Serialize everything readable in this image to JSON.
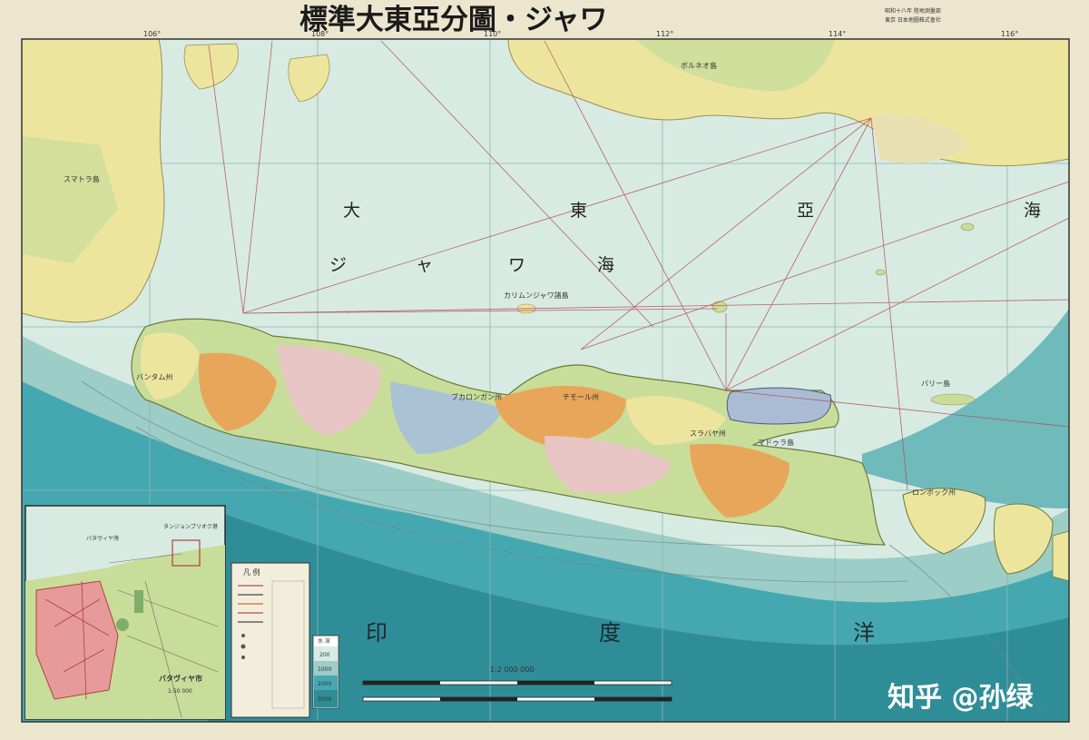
{
  "map": {
    "title": "標準大東亞分圖・ジャワ",
    "sea_labels": [
      "大",
      "東",
      "亞",
      "海",
      "ジ",
      "ャ",
      "ワ",
      "海"
    ],
    "ocean_labels": [
      "印",
      "度",
      "洋"
    ],
    "regions": [
      "バンタム州",
      "チモール州",
      "ブカロンガン州",
      "スラバヤ州",
      "マドゥラ島",
      "バリー島",
      "ロンボック州",
      "カリムンジャワ諸島",
      "ボルネオ島",
      "スマトラ島"
    ],
    "longitude_ticks": [
      "106°",
      "108°",
      "110°",
      "112°",
      "114°",
      "116°"
    ],
    "scale_text": "1:2 000 000",
    "legend": {
      "title": "凡 例",
      "depth_header": "水 深",
      "depth_steps": [
        "200",
        "1000",
        "2000",
        "3000"
      ]
    },
    "inset": {
      "label_sea": "バタヴィヤ灣",
      "label_harbor": "タンジョンプリオク港",
      "title": "バタヴィヤ市",
      "scale": "1:50 000"
    },
    "publisher_lines": [
      "昭和十八年 陸地測量部",
      "東京 日本地圖株式會社"
    ],
    "watermark": "知乎 @孙绿"
  },
  "colors": {
    "sea_shallow": "#d7ebe2",
    "sea_mid": "#9ccdc6",
    "sea_deep": "#45a8b0",
    "sea_deepest": "#2f8d98",
    "land_yellow": "#ede59e",
    "land_green": "#c8dd9a",
    "land_orange": "#e8a65a",
    "land_pink": "#e8c5c5",
    "route": "#b5485d",
    "paper": "#ece6cf"
  }
}
